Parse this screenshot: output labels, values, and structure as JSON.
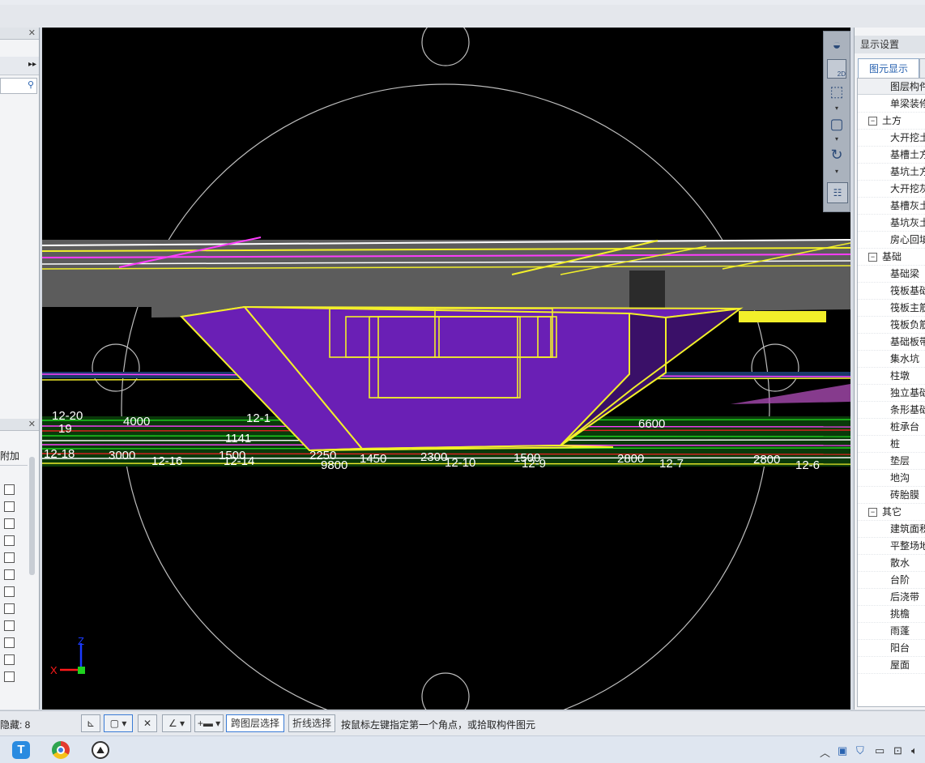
{
  "left_panel": {
    "column_header": "附加",
    "checkbox_count": 12
  },
  "right_panel": {
    "title": "显示设置",
    "tab_active": "图元显示",
    "list_header": "图层构件",
    "items": [
      {
        "label": "单梁装修",
        "group": false
      },
      {
        "label": "土方",
        "group": true
      },
      {
        "label": "大开挖土",
        "group": false
      },
      {
        "label": "基槽土方",
        "group": false
      },
      {
        "label": "基坑土方",
        "group": false
      },
      {
        "label": "大开挖灰",
        "group": false
      },
      {
        "label": "基槽灰土",
        "group": false
      },
      {
        "label": "基坑灰土",
        "group": false
      },
      {
        "label": "房心回填",
        "group": false
      },
      {
        "label": "基础",
        "group": true
      },
      {
        "label": "基础梁",
        "group": false
      },
      {
        "label": "筏板基础",
        "group": false
      },
      {
        "label": "筏板主筋",
        "group": false
      },
      {
        "label": "筏板负筋",
        "group": false
      },
      {
        "label": "基础板带",
        "group": false
      },
      {
        "label": "集水坑",
        "group": false
      },
      {
        "label": "柱墩",
        "group": false
      },
      {
        "label": "独立基础",
        "group": false
      },
      {
        "label": "条形基础",
        "group": false
      },
      {
        "label": "桩承台",
        "group": false
      },
      {
        "label": "桩",
        "group": false
      },
      {
        "label": "垫层",
        "group": false
      },
      {
        "label": "地沟",
        "group": false
      },
      {
        "label": "砖胎膜",
        "group": false
      },
      {
        "label": "其它",
        "group": true
      },
      {
        "label": "建筑面积",
        "group": false
      },
      {
        "label": "平整场地",
        "group": false
      },
      {
        "label": "散水",
        "group": false
      },
      {
        "label": "台阶",
        "group": false
      },
      {
        "label": "后浇带",
        "group": false
      },
      {
        "label": "挑檐",
        "group": false
      },
      {
        "label": "雨蓬",
        "group": false
      },
      {
        "label": "阳台",
        "group": false
      },
      {
        "label": "屋面",
        "group": false
      }
    ]
  },
  "view_tools": {
    "mode_2d": "2D"
  },
  "viewport": {
    "dimensions": [
      {
        "text": "4000"
      },
      {
        "text": "12-20"
      },
      {
        "text": "19"
      },
      {
        "text": "12-18"
      },
      {
        "text": "3000"
      },
      {
        "text": "12-16"
      },
      {
        "text": "1500"
      },
      {
        "text": "12-14"
      },
      {
        "text": "2250"
      },
      {
        "text": "9800"
      },
      {
        "text": "1450"
      },
      {
        "text": "2300"
      },
      {
        "text": "12-10"
      },
      {
        "text": "1500"
      },
      {
        "text": "12-9"
      },
      {
        "text": "2800"
      },
      {
        "text": "12-7"
      },
      {
        "text": "2800"
      },
      {
        "text": "12-6"
      },
      {
        "text": "6600"
      },
      {
        "text": "1141"
      },
      {
        "text": "12-1"
      }
    ],
    "axis_z": "Z",
    "axis_x": "X"
  },
  "status_bar": {
    "hidden_count": "隐藏: 8",
    "cross_layer_select": "跨图层选择",
    "polyline_select": "折线选择",
    "prompt": "按鼠标左键指定第一个角点，或拾取构件图元"
  },
  "colors": {
    "pit_fill": "#6a1fb5",
    "pit_outline": "#f2ef2a",
    "slab": "#5c5c5c",
    "magenta": "#ff3cff",
    "green": "#1fd21f"
  }
}
